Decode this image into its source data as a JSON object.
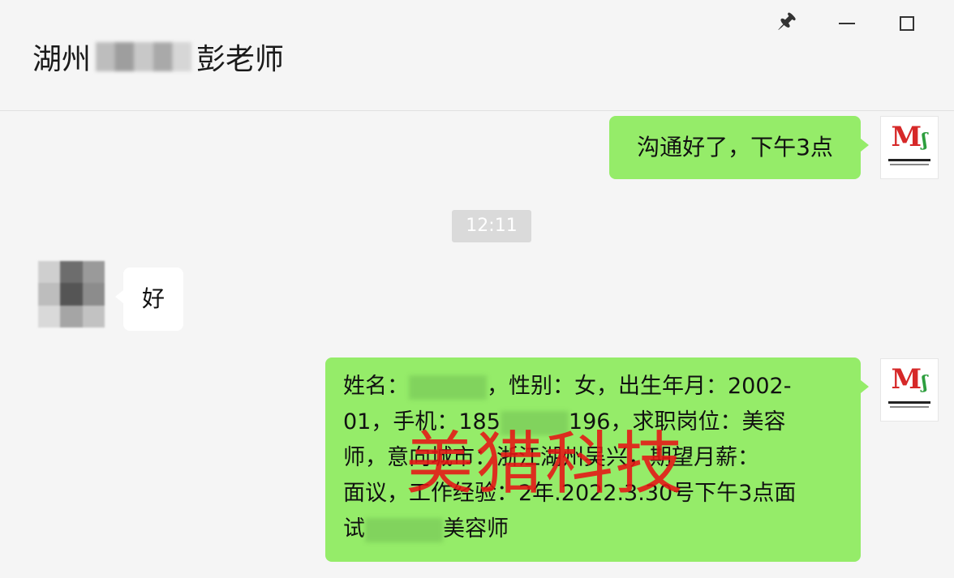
{
  "header": {
    "title_prefix": "湖州",
    "title_suffix": "彭老师",
    "pin_icon": "pin-icon",
    "minimize_icon": "minimize-icon",
    "maximize_icon": "maximize-icon"
  },
  "messages": [
    {
      "direction": "out",
      "text": "沟通好了，下午3点"
    },
    {
      "type": "timestamp",
      "text": "12:11"
    },
    {
      "direction": "in",
      "text": "好"
    },
    {
      "direction": "out",
      "lines": [
        "姓名：",
        "，性别：女，出生年月：2002-",
        "01，手机：185",
        "196，求职岗位：美容",
        "师，意向城市：浙江湖州吴兴，期望月薪：",
        "面议，工作经验：2年.2022.3.30号下午3点面",
        "试",
        "美容师"
      ]
    }
  ],
  "watermark": "美猎科技",
  "colors": {
    "outgoing_bubble": "#95ec69",
    "incoming_bubble": "#ffffff",
    "background": "#f5f5f5",
    "watermark": "#e61414"
  }
}
